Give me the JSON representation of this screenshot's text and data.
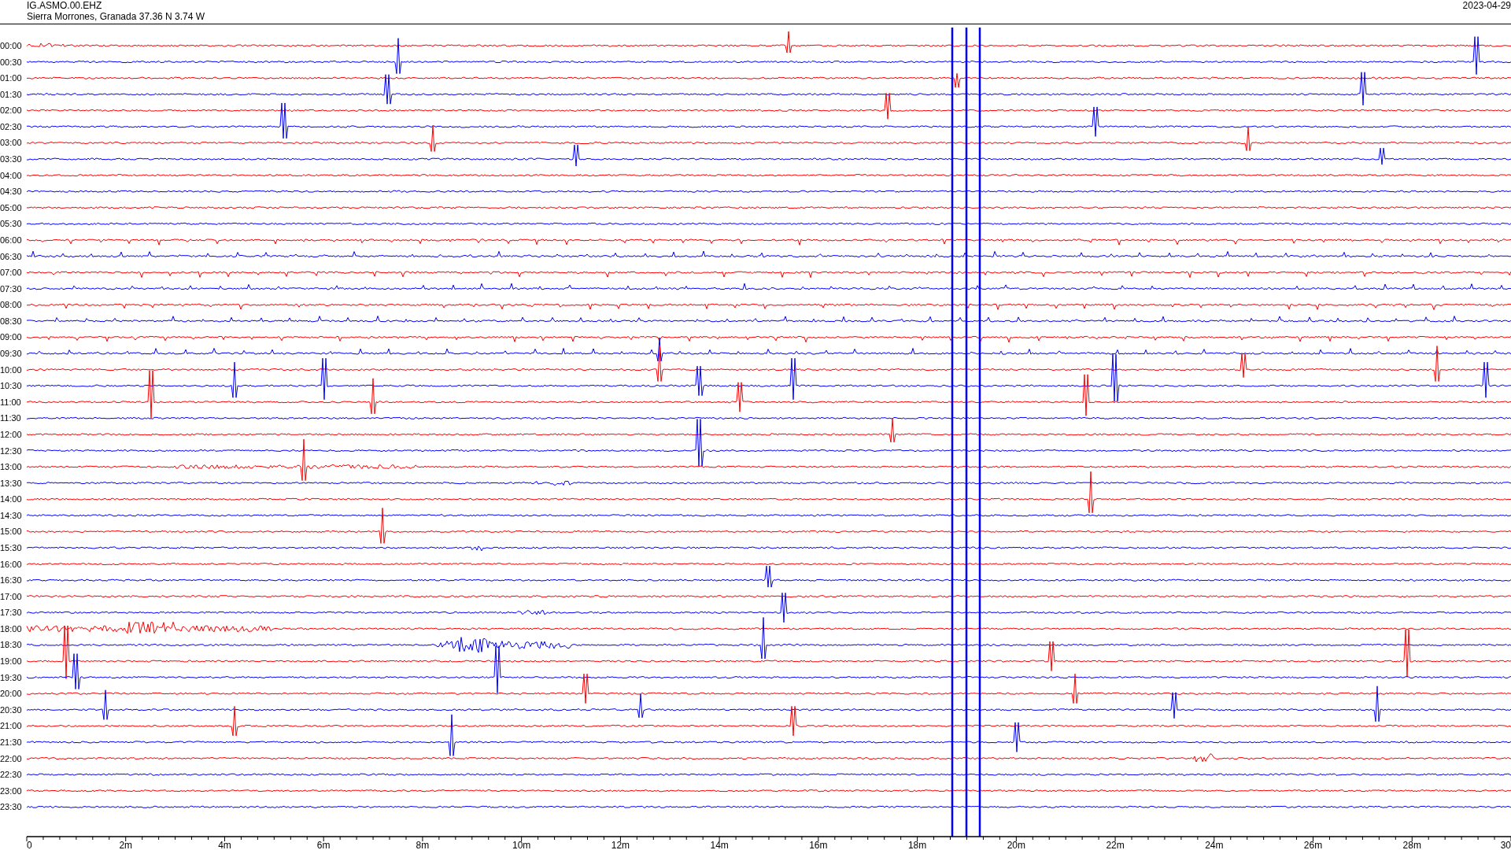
{
  "header": {
    "channel": "IG.ASMO.00.EHZ",
    "station": "Sierra Morrones, Granada  37.36 N 3.74 W",
    "date": "2023-04-29"
  },
  "rows": [
    {
      "time": "00:00",
      "color": "#ff0000"
    },
    {
      "time": "00:30",
      "color": "#0000ff"
    },
    {
      "time": "01:00",
      "color": "#ff0000"
    },
    {
      "time": "01:30",
      "color": "#0000ff"
    },
    {
      "time": "02:00",
      "color": "#ff0000"
    },
    {
      "time": "02:30",
      "color": "#0000ff"
    },
    {
      "time": "03:00",
      "color": "#ff0000"
    },
    {
      "time": "03:30",
      "color": "#0000ff"
    },
    {
      "time": "04:00",
      "color": "#ff0000"
    },
    {
      "time": "04:30",
      "color": "#0000ff"
    },
    {
      "time": "05:00",
      "color": "#ff0000"
    },
    {
      "time": "05:30",
      "color": "#0000ff"
    },
    {
      "time": "06:00",
      "color": "#ff0000"
    },
    {
      "time": "06:30",
      "color": "#0000ff"
    },
    {
      "time": "07:00",
      "color": "#ff0000"
    },
    {
      "time": "07:30",
      "color": "#0000ff"
    },
    {
      "time": "08:00",
      "color": "#ff0000"
    },
    {
      "time": "08:30",
      "color": "#0000ff"
    },
    {
      "time": "09:00",
      "color": "#ff0000"
    },
    {
      "time": "09:30",
      "color": "#0000ff"
    },
    {
      "time": "10:00",
      "color": "#ff0000"
    },
    {
      "time": "10:30",
      "color": "#0000ff"
    },
    {
      "time": "11:00",
      "color": "#ff0000"
    },
    {
      "time": "11:30",
      "color": "#0000ff"
    },
    {
      "time": "12:00",
      "color": "#ff0000"
    },
    {
      "time": "12:30",
      "color": "#0000ff"
    },
    {
      "time": "13:00",
      "color": "#ff0000"
    },
    {
      "time": "13:30",
      "color": "#0000ff"
    },
    {
      "time": "14:00",
      "color": "#ff0000"
    },
    {
      "time": "14:30",
      "color": "#0000ff"
    },
    {
      "time": "15:00",
      "color": "#ff0000"
    },
    {
      "time": "15:30",
      "color": "#0000ff"
    },
    {
      "time": "16:00",
      "color": "#ff0000"
    },
    {
      "time": "16:30",
      "color": "#0000ff"
    },
    {
      "time": "17:00",
      "color": "#ff0000"
    },
    {
      "time": "17:30",
      "color": "#0000ff"
    },
    {
      "time": "18:00",
      "color": "#ff0000"
    },
    {
      "time": "18:30",
      "color": "#0000ff"
    },
    {
      "time": "19:00",
      "color": "#ff0000"
    },
    {
      "time": "19:30",
      "color": "#0000ff"
    },
    {
      "time": "20:00",
      "color": "#ff0000"
    },
    {
      "time": "20:30",
      "color": "#0000ff"
    },
    {
      "time": "21:00",
      "color": "#ff0000"
    },
    {
      "time": "21:30",
      "color": "#0000ff"
    },
    {
      "time": "22:00",
      "color": "#ff0000"
    },
    {
      "time": "22:30",
      "color": "#0000ff"
    },
    {
      "time": "23:00",
      "color": "#ff0000"
    },
    {
      "time": "23:30",
      "color": "#0000ff"
    }
  ],
  "time_axis": {
    "ticks": [
      "0",
      "2m",
      "4m",
      "6m",
      "8m",
      "10m",
      "12m",
      "14m",
      "16m",
      "18m",
      "20m",
      "22m",
      "24m",
      "26m",
      "28m",
      "30"
    ]
  }
}
